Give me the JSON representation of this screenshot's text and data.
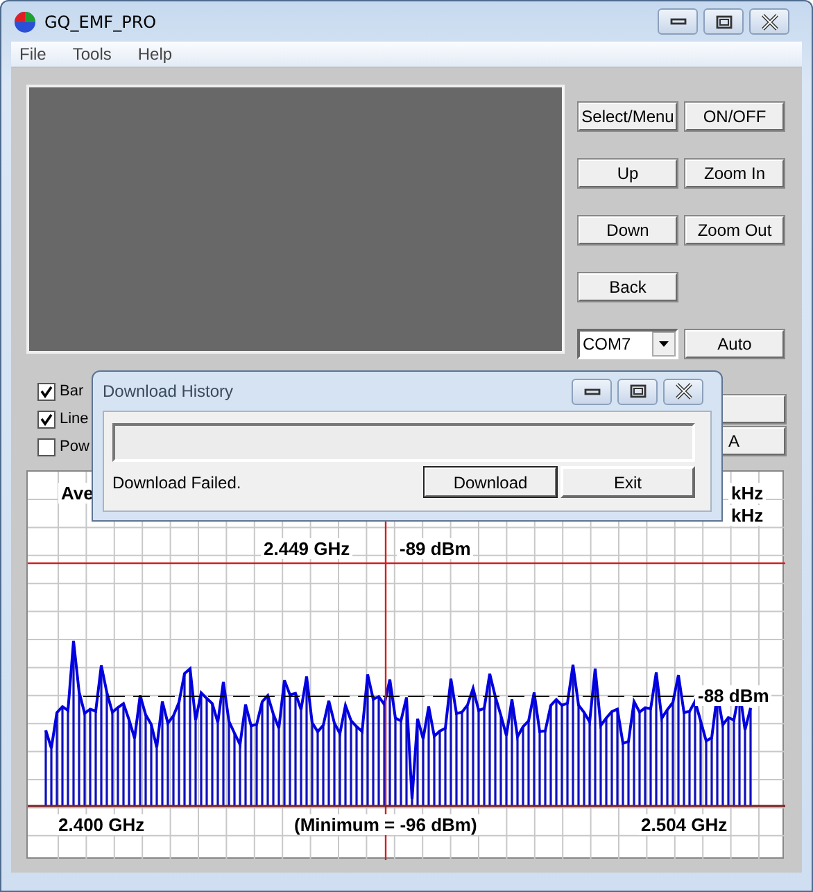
{
  "window": {
    "title": "GQ_EMF_PRO"
  },
  "menu": [
    {
      "label": "File"
    },
    {
      "label": "Tools"
    },
    {
      "label": "Help"
    }
  ],
  "button_rows": [
    {
      "buttons": [
        {
          "label": "Select/Menu"
        },
        {
          "label": "ON/OFF"
        }
      ]
    },
    {
      "buttons": [
        {
          "label": "Up"
        },
        {
          "label": "Zoom In"
        }
      ]
    },
    {
      "buttons": [
        {
          "label": "Down"
        },
        {
          "label": "Zoom Out"
        }
      ]
    },
    {
      "buttons": [
        {
          "label": "Back"
        }
      ]
    }
  ],
  "port": {
    "value": "COM7",
    "button": "Auto"
  },
  "checkboxes": [
    {
      "label": "Bar",
      "checked": true
    },
    {
      "label": "Line",
      "checked": true
    },
    {
      "label": "Pow",
      "checked": false
    }
  ],
  "lower_button": {
    "label": "A"
  },
  "chart": {
    "top_left": "Ave",
    "right_1": "kHz",
    "right_2": "kHz",
    "cursor_freq": "2.449 GHz",
    "cursor_level": "-89 dBm",
    "average_level": "-88 dBm",
    "start_freq": "2.400 GHz",
    "minimum": "(Minimum = -96 dBm)",
    "end_freq": "2.504 GHz"
  },
  "dialog": {
    "title": "Download History",
    "progress": {
      "level": 0
    },
    "message": "Download Failed.",
    "buttons": [
      {
        "label": "Download",
        "selected": true
      },
      {
        "label": "Exit",
        "selected": false
      }
    ]
  }
}
